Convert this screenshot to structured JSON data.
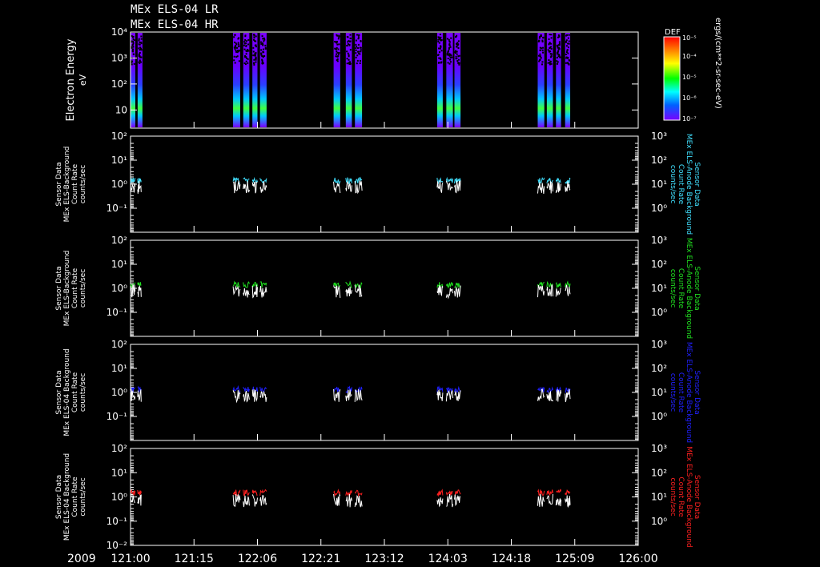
{
  "header": {
    "line1": "MEx ELS-04 LR",
    "line2": "MEx ELS-04 HR"
  },
  "time_axis": {
    "year": "2009",
    "ticks": [
      "121:00",
      "121:15",
      "122:06",
      "122:21",
      "123:12",
      "124:03",
      "124:18",
      "125:09",
      "126:00"
    ]
  },
  "colorbar": {
    "label": "DEF",
    "ticks": [
      "10⁻⁵",
      "10⁻⁴",
      "10⁻⁵",
      "10⁻⁶",
      "10⁻⁷"
    ],
    "units": "ergs/(cm**2-sr-sec-eV)",
    "colors": [
      "#ff0000",
      "#ff8000",
      "#ffff00",
      "#00ff00",
      "#00ffff",
      "#0060ff",
      "#7a00ff"
    ]
  },
  "chart_data": [
    {
      "type": "heatmap",
      "ylabel": "Electron Energy",
      "yunits": "eV",
      "yscale": "log",
      "ylim": [
        2,
        10000
      ],
      "yticks": [
        "10⁴",
        "10³",
        "10²",
        "10"
      ],
      "data_intervals": [
        [
          121.0,
          121.045
        ],
        [
          121.07,
          121.105
        ],
        [
          122.01,
          122.08
        ],
        [
          122.11,
          122.17
        ],
        [
          122.2,
          122.25
        ],
        [
          122.275,
          122.34
        ],
        [
          123.0,
          123.065
        ],
        [
          123.12,
          123.18
        ],
        [
          123.21,
          123.28
        ],
        [
          124.02,
          124.075
        ],
        [
          124.11,
          124.175
        ],
        [
          124.19,
          124.25
        ],
        [
          125.01,
          125.075
        ],
        [
          125.1,
          125.16
        ],
        [
          125.19,
          125.24
        ],
        [
          125.28,
          125.33
        ]
      ]
    },
    {
      "type": "line",
      "ylabel_left": [
        "Sensor Data",
        "MEx ELS-Background",
        "Count Rate",
        "counts/sec"
      ],
      "ylabel_right": [
        "Sensor Data",
        "MEx ELS-Anode Background",
        "Count Rate",
        "counts/sec"
      ],
      "yscale": "log",
      "ylim_left": [
        0.01,
        100
      ],
      "ylim_right": [
        0.1,
        1000
      ],
      "yticks_left": [
        "10²",
        "10¹",
        "10⁰",
        "10⁻¹"
      ],
      "yticks_right": [
        "10³",
        "10²",
        "10¹",
        "10⁰"
      ],
      "series": [
        {
          "color": "#40e0ff",
          "level": 1.4
        },
        {
          "color": "#ffffff",
          "level": 0.75
        }
      ]
    },
    {
      "type": "line",
      "ylabel_left": [
        "Sensor Data",
        "MEx ELS-Background",
        "Count Rate",
        "counts/sec"
      ],
      "ylabel_right": [
        "Sensor Data",
        "MEx ELS-Anode Background",
        "Count Rate",
        "counts/sec"
      ],
      "yscale": "log",
      "ylim_left": [
        0.01,
        100
      ],
      "ylim_right": [
        0.1,
        1000
      ],
      "yticks_left": [
        "10²",
        "10¹",
        "10⁰",
        "10⁻¹"
      ],
      "yticks_right": [
        "10³",
        "10²",
        "10¹",
        "10⁰"
      ],
      "series": [
        {
          "color": "#20e020",
          "level": 1.4
        },
        {
          "color": "#ffffff",
          "level": 0.75
        }
      ]
    },
    {
      "type": "line",
      "ylabel_left": [
        "Sensor Data",
        "MEx ELS-04 Background",
        "Count Rate",
        "counts/sec"
      ],
      "ylabel_right": [
        "Sensor Data",
        "MEx ELS-Anode Background",
        "Count Rate",
        "counts/sec"
      ],
      "yscale": "log",
      "ylim_left": [
        0.01,
        100
      ],
      "ylim_right": [
        0.1,
        1000
      ],
      "yticks_left": [
        "10²",
        "10¹",
        "10⁰",
        "10⁻¹"
      ],
      "yticks_right": [
        "10³",
        "10²",
        "10¹",
        "10⁰"
      ],
      "series": [
        {
          "color": "#2020ff",
          "level": 1.3
        },
        {
          "color": "#ffffff",
          "level": 0.75
        }
      ]
    },
    {
      "type": "line",
      "ylabel_left": [
        "Sensor Data",
        "MEx ELS-04 Background",
        "Count Rate",
        "counts/sec"
      ],
      "ylabel_right": [
        "Sensor Data",
        "MEx ELS-Anode Background",
        "Count Rate",
        "counts/sec"
      ],
      "yscale": "log",
      "ylim_left": [
        0.01,
        100
      ],
      "ylim_right": [
        0.1,
        1000
      ],
      "yticks_left": [
        "10²",
        "10¹",
        "10⁰",
        "10⁻¹",
        "10⁻²"
      ],
      "yticks_right": [
        "10³",
        "10²",
        "10¹",
        "10⁰"
      ],
      "series": [
        {
          "color": "#ff2020",
          "level": 1.5
        },
        {
          "color": "#ffffff",
          "level": 0.7
        }
      ]
    }
  ]
}
